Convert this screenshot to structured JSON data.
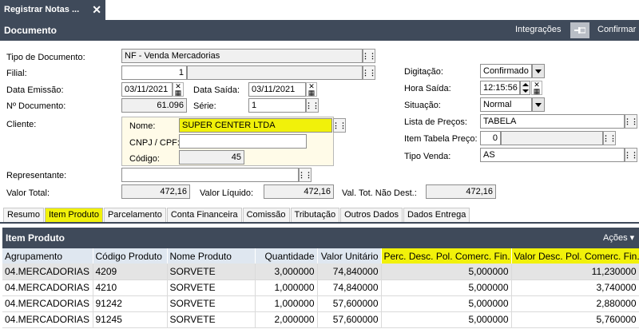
{
  "window_tab": {
    "title": "Registrar Notas ...",
    "close_glyph": "✕"
  },
  "header": {
    "title": "Documento",
    "integracoes_label": "Integrações",
    "pin_icon": "pin-icon",
    "confirmar_label": "Confirmar"
  },
  "form": {
    "tipo_documento": {
      "label": "Tipo de Documento:",
      "value": "NF - Venda Mercadorias"
    },
    "filial": {
      "label": "Filial:",
      "value": "1"
    },
    "data_emissao": {
      "label": "Data Emissão:",
      "value": "03/11/2021"
    },
    "data_saida": {
      "label": "Data Saída:",
      "value": "03/11/2021"
    },
    "numero_documento": {
      "label": "Nº Documento:",
      "value": "61.096"
    },
    "serie": {
      "label": "Série:",
      "value": "1"
    },
    "cliente": {
      "label": "Cliente:",
      "nome_label": "Nome:",
      "nome_value": "SUPER CENTER LTDA",
      "cnpj_label": "CNPJ / CPF:",
      "cnpj_value": "",
      "codigo_label": "Código:",
      "codigo_value": "45"
    },
    "representante": {
      "label": "Representante:",
      "value": ""
    },
    "valor_total": {
      "label": "Valor Total:",
      "value": "472,16"
    },
    "valor_liquido": {
      "label": "Valor Líquido:",
      "value": "472,16"
    },
    "val_tot_nao_dest": {
      "label": "Val. Tot. Não Dest.:",
      "value": "472,16"
    },
    "digitacao": {
      "label": "Digitação:",
      "value": "Confirmado"
    },
    "hora_saida": {
      "label": "Hora Saída:",
      "value": "12:15:56"
    },
    "situacao": {
      "label": "Situação:",
      "value": "Normal"
    },
    "lista_precos": {
      "label": "Lista de Preços:",
      "value": "TABELA"
    },
    "item_tabela_preco": {
      "label": "Item Tabela Preço:",
      "value": "0"
    },
    "tipo_venda": {
      "label": "Tipo Venda:",
      "value": "AS"
    }
  },
  "tabs": [
    "Resumo",
    "Item Produto",
    "Parcelamento",
    "Conta Financeira",
    "Comissão",
    "Tributação",
    "Outros Dados",
    "Dados Entrega"
  ],
  "active_tab": "Item Produto",
  "grid": {
    "title": "Item Produto",
    "acoes_label": "Ações",
    "columns": [
      "Agrupamento",
      "Código Produto",
      "Nome Produto",
      "Quantidade",
      "Valor Unitário",
      "Perc. Desc. Pol. Comerc. Fin.",
      "Valor Desc. Pol. Comerc. Fin."
    ],
    "rows": [
      [
        "04.MERCADORIAS",
        "4209",
        "SORVETE",
        "3,000000",
        "74,840000",
        "5,000000",
        "11,230000"
      ],
      [
        "04.MERCADORIAS",
        "4210",
        "SORVETE",
        "1,000000",
        "74,840000",
        "5,000000",
        "3,740000"
      ],
      [
        "04.MERCADORIAS",
        "91242",
        "SORVETE",
        "1,000000",
        "57,600000",
        "5,000000",
        "2,880000"
      ],
      [
        "04.MERCADORIAS",
        "91245",
        "SORVETE",
        "2,000000",
        "57,600000",
        "5,000000",
        "5,760000"
      ]
    ]
  },
  "colors": {
    "header_bg": "#3f4a5a",
    "highlight": "#f1f10a",
    "grid_header_bg": "#dfe7f0"
  }
}
